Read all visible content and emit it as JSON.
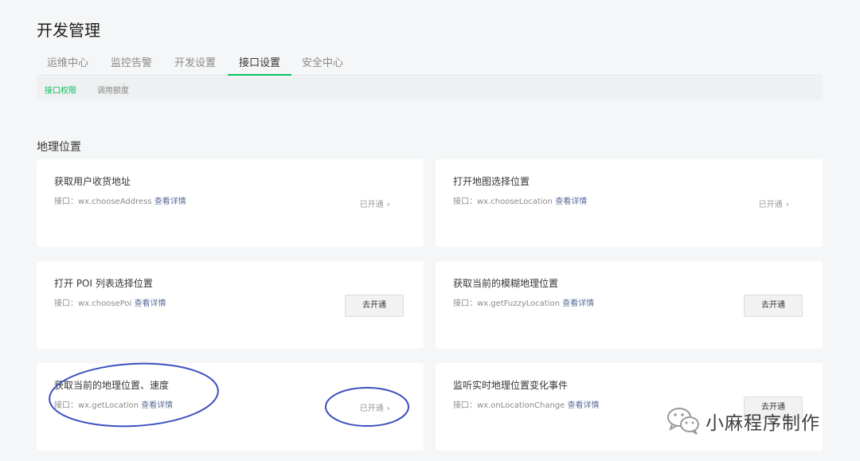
{
  "page_title": "开发管理",
  "tabs": [
    {
      "label": "运维中心"
    },
    {
      "label": "监控告警"
    },
    {
      "label": "开发设置"
    },
    {
      "label": "接口设置",
      "active": true
    },
    {
      "label": "安全中心"
    }
  ],
  "subnav": {
    "items": [
      {
        "label": "接口权限",
        "active": true
      },
      {
        "label": "调用额度"
      }
    ]
  },
  "section_title": "地理位置",
  "colors": {
    "accent": "#07c160",
    "link": "#576b95",
    "annotation": "#3b4fc0"
  },
  "cards": [
    {
      "title": "获取用户收货地址",
      "api_prefix": "接口：wx.chooseAddress",
      "detail_link": "查看详情",
      "status": "已开通"
    },
    {
      "title": "打开地图选择位置",
      "api_prefix": "接口：wx.chooseLocation",
      "detail_link": "查看详情",
      "status": "已开通"
    },
    {
      "title": "打开 POI 列表选择位置",
      "api_prefix": "接口：wx.choosePoi",
      "detail_link": "查看详情",
      "button": "去开通"
    },
    {
      "title": "获取当前的模糊地理位置",
      "api_prefix": "接口：wx.getFuzzyLocation",
      "detail_link": "查看详情",
      "button": "去开通"
    },
    {
      "title": "获取当前的地理位置、速度",
      "api_prefix": "接口：wx.getLocation",
      "detail_link": "查看详情",
      "status": "已开通"
    },
    {
      "title": "监听实时地理位置变化事件",
      "api_prefix": "接口：wx.onLocationChange",
      "detail_link": "查看详情",
      "button": "去开通"
    }
  ],
  "watermark": {
    "text": "小麻程序制作",
    "icon": "wechat-icon"
  }
}
